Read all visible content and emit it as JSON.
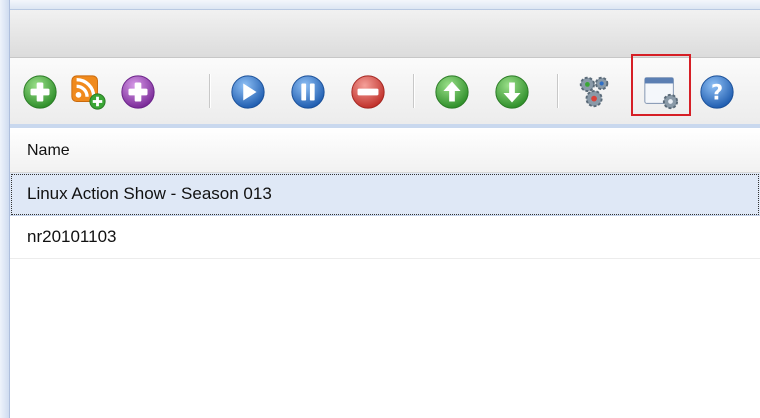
{
  "toolbar": {
    "buttons": [
      {
        "name": "add-torrent-button",
        "icon": "plus-circle-icon",
        "color": "#3aa635"
      },
      {
        "name": "add-rss-feed-button",
        "icon": "rss-plus-icon",
        "color": "#f08a1d"
      },
      {
        "name": "add-item-button",
        "icon": "plus-circle-icon",
        "color": "#8b3aa8"
      },
      {
        "name": "start-button",
        "icon": "play-icon",
        "color": "#2f6fc6"
      },
      {
        "name": "pause-button",
        "icon": "pause-icon",
        "color": "#2f6fc6"
      },
      {
        "name": "remove-button",
        "icon": "minus-circle-icon",
        "color": "#d9423a"
      },
      {
        "name": "move-up-button",
        "icon": "arrow-up-circle-icon",
        "color": "#3aa635"
      },
      {
        "name": "move-down-button",
        "icon": "arrow-down-circle-icon",
        "color": "#3aa635"
      },
      {
        "name": "settings-button",
        "icon": "gears-icon",
        "color": "#7a8a99"
      },
      {
        "name": "preferences-window-button",
        "icon": "window-gear-icon",
        "color": "#5b7fb3"
      },
      {
        "name": "help-button",
        "icon": "help-circle-icon",
        "color": "#2f6fc6"
      }
    ],
    "highlight_color": "#d61f26"
  },
  "table": {
    "columns": [
      "Name"
    ],
    "rows": [
      {
        "name": "Linux Action Show - Season 013",
        "selected": true
      },
      {
        "name": "nr20101103",
        "selected": false
      }
    ]
  },
  "colors": {
    "selection": "#dfe8f6",
    "frame": "#c9d8ee"
  }
}
